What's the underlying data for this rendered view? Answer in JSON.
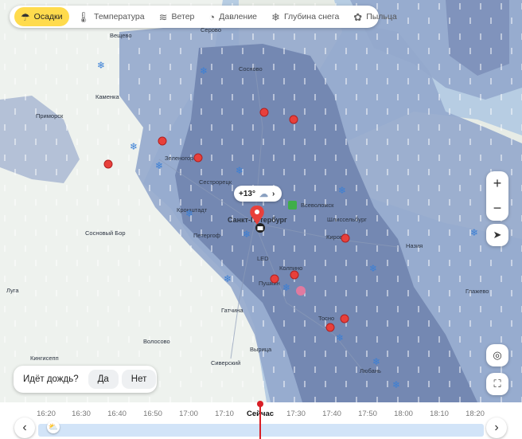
{
  "tabs": [
    {
      "label": "Осадки",
      "icon": "umbrella-icon",
      "active": true
    },
    {
      "label": "Температура",
      "icon": "thermometer-icon",
      "active": false
    },
    {
      "label": "Ветер",
      "icon": "wind-icon",
      "active": false
    },
    {
      "label": "Давление",
      "icon": "pressure-gauge-icon",
      "active": false
    },
    {
      "label": "Глубина снега",
      "icon": "snowflake-icon",
      "active": false
    },
    {
      "label": "Пыльца",
      "icon": "pollen-flower-icon",
      "active": false
    }
  ],
  "map": {
    "places": [
      {
        "name": "Серово"
      },
      {
        "name": "Вещево"
      },
      {
        "name": "Сосново"
      },
      {
        "name": "Каменка"
      },
      {
        "name": "Приморск"
      },
      {
        "name": "Зеленогорск"
      },
      {
        "name": "Сестрорецк"
      },
      {
        "name": "Всеволожск"
      },
      {
        "name": "Кронштадт"
      },
      {
        "name": "Санкт-Петербург"
      },
      {
        "name": "Шлиссельбург"
      },
      {
        "name": "Петергоф"
      },
      {
        "name": "Кировск"
      },
      {
        "name": "Сосновый Бор"
      },
      {
        "name": "LED"
      },
      {
        "name": "Колпино"
      },
      {
        "name": "Пушкин"
      },
      {
        "name": "Назия"
      },
      {
        "name": "Луга"
      },
      {
        "name": "Гатчина"
      },
      {
        "name": "Глажево"
      },
      {
        "name": "Тосно"
      },
      {
        "name": "Волосово"
      },
      {
        "name": "Кингисепп"
      },
      {
        "name": "Вырица"
      },
      {
        "name": "Сиверский"
      },
      {
        "name": "Любань"
      }
    ],
    "weather_bubble": {
      "temp": "+13°",
      "icon": "partly-cloudy-rain-icon"
    },
    "colors": {
      "water": "#b7cde3",
      "land": "#eef2ee",
      "precip_light": "#94a9cc",
      "precip_heavy": "#6d81ad",
      "marker": "#e8403b",
      "snow_marker": "#3a7fd6"
    }
  },
  "controls": {
    "zoom_in": "+",
    "zoom_out": "−"
  },
  "rain_question": {
    "question": "Идёт дождь?",
    "yes": "Да",
    "no": "Нет"
  },
  "timeline": {
    "labels": [
      "16:20",
      "16:30",
      "16:40",
      "16:50",
      "17:00",
      "17:10",
      "Сейчас",
      "17:30",
      "17:40",
      "17:50",
      "18:00",
      "18:10",
      "18:20"
    ],
    "current": "Сейчас"
  }
}
